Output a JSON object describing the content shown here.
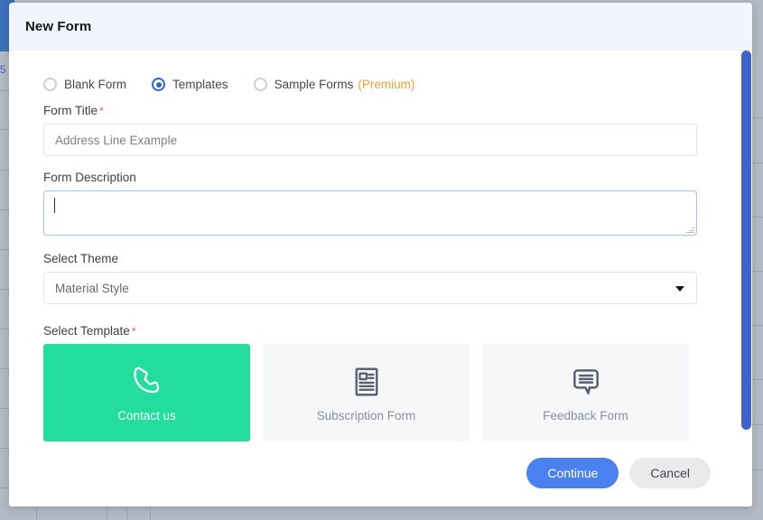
{
  "modal": {
    "title": "New Form",
    "form_type_options": [
      {
        "label": "Blank Form",
        "selected": false,
        "badge": ""
      },
      {
        "label": "Templates",
        "selected": true,
        "badge": ""
      },
      {
        "label": "Sample Forms",
        "selected": false,
        "badge": "(Premium)"
      }
    ],
    "form_title": {
      "label": "Form Title",
      "required_mark": "*",
      "value": "Address Line Example",
      "placeholder": "Address Line Example"
    },
    "form_description": {
      "label": "Form Description",
      "value": "",
      "placeholder": ""
    },
    "select_theme": {
      "label": "Select Theme",
      "value": "Material Style",
      "arrow_icon": "chevron-down-icon"
    },
    "select_template": {
      "label": "Select Template",
      "required_mark": "*",
      "cards": [
        {
          "label": "Contact us",
          "icon": "phone-icon",
          "selected": true
        },
        {
          "label": "Subscription Form",
          "icon": "newspaper-icon",
          "selected": false
        },
        {
          "label": "Feedback Form",
          "icon": "speech-bubble-icon",
          "selected": false
        }
      ]
    },
    "actions": {
      "continue_label": "Continue",
      "cancel_label": "Cancel"
    },
    "scrollbar": {
      "name": "modal-vertical-scrollbar"
    }
  },
  "background": {
    "left_edge_glyph": "5"
  },
  "colors": {
    "accent_blue": "#4a80f0",
    "selected_card_green": "#22dd9c",
    "premium_orange": "#eda435",
    "required_red": "#f0565b",
    "header_bg": "#f2f5fd",
    "scrollbar_blue": "#3e63c8",
    "background_gray": "#b3bac5"
  }
}
